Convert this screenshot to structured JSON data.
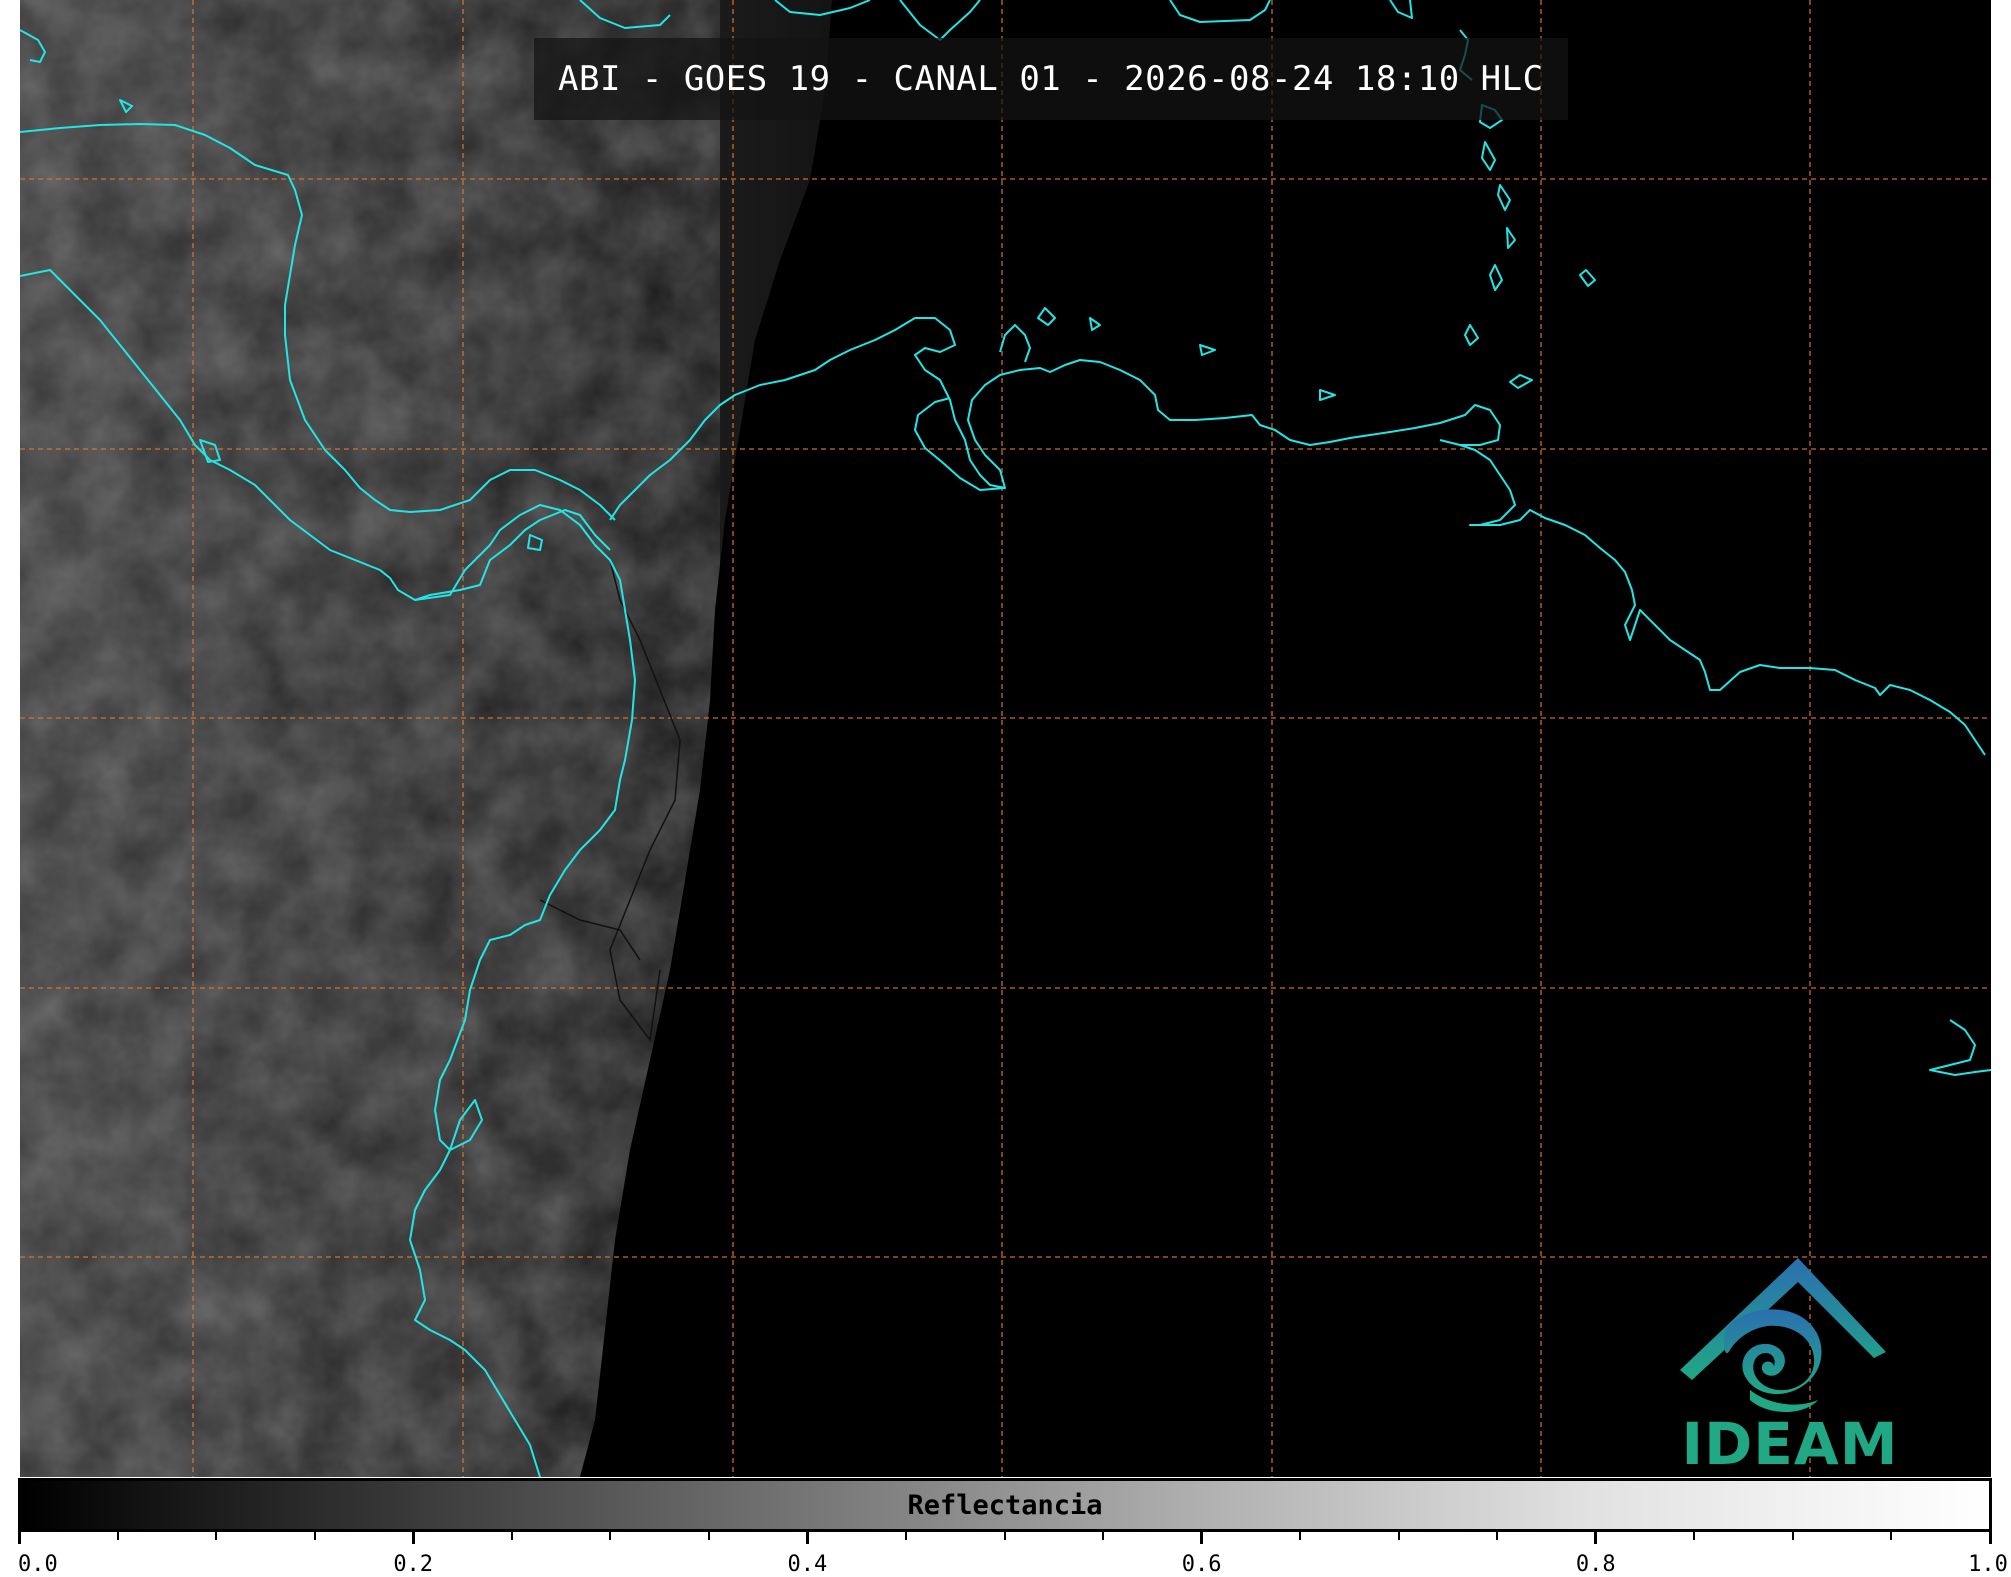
{
  "title": "ABI - GOES 19 - CANAL 01 - 2026-08-24 18:10 HLC",
  "colorbar": {
    "label": "Reflectancia",
    "min": 0.0,
    "max": 1.0,
    "major_ticks": [
      "0.0",
      "0.2",
      "0.4",
      "0.6",
      "0.8",
      "1.0"
    ],
    "minor_tick_step": 0.05
  },
  "logo": {
    "text": "IDEAM"
  },
  "colors": {
    "coastline": "#22e5e5",
    "grid": "#e0782a",
    "ocean": "#000000",
    "logo_blue": "#2b6fb0",
    "logo_green": "#20a884"
  }
}
